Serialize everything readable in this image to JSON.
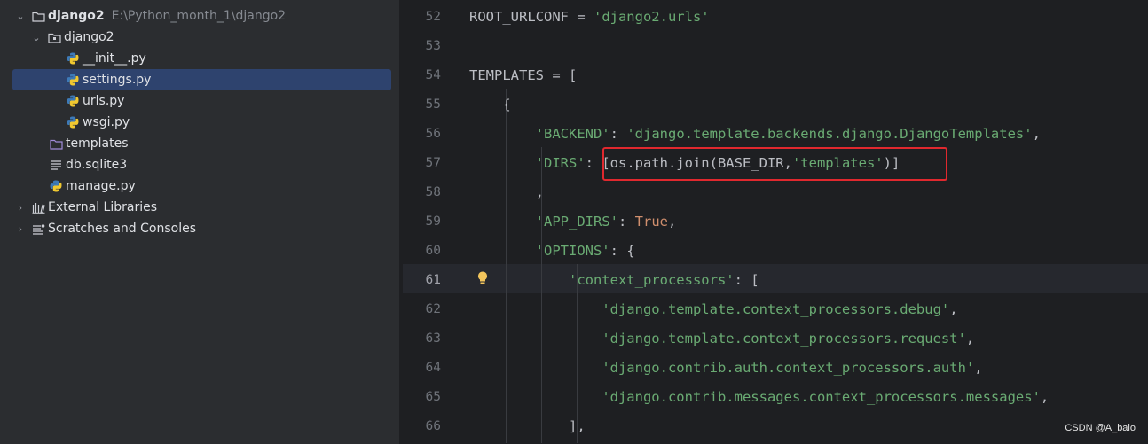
{
  "project_tree": {
    "root": {
      "name": "django2",
      "path": "E:\\Python_month_1\\django2"
    },
    "items": [
      {
        "label": "django2",
        "icon": "folder-icon"
      },
      {
        "label": "__init__.py",
        "icon": "python-file-icon"
      },
      {
        "label": "settings.py",
        "icon": "python-file-icon",
        "selected": true
      },
      {
        "label": "urls.py",
        "icon": "python-file-icon"
      },
      {
        "label": "wsgi.py",
        "icon": "python-file-icon"
      },
      {
        "label": "templates",
        "icon": "folder-icon"
      },
      {
        "label": "db.sqlite3",
        "icon": "text-file-icon"
      },
      {
        "label": "manage.py",
        "icon": "python-file-icon"
      },
      {
        "label": "External Libraries",
        "icon": "library-icon"
      },
      {
        "label": "Scratches and Consoles",
        "icon": "scratches-icon"
      }
    ]
  },
  "editor": {
    "current_line": "61",
    "lines": [
      {
        "num": "52",
        "tokens": [
          [
            "p",
            "ROOT_URLCONF = "
          ],
          [
            "s",
            "'django2.urls'"
          ]
        ]
      },
      {
        "num": "53",
        "tokens": []
      },
      {
        "num": "54",
        "tokens": [
          [
            "p",
            "TEMPLATES = ["
          ]
        ]
      },
      {
        "num": "55",
        "tokens": [
          [
            "p",
            "    {"
          ]
        ]
      },
      {
        "num": "56",
        "tokens": [
          [
            "p",
            "        "
          ],
          [
            "s",
            "'BACKEND'"
          ],
          [
            "p",
            ": "
          ],
          [
            "s",
            "'django.template.backends.django.DjangoTemplates'"
          ],
          [
            "p",
            ","
          ]
        ]
      },
      {
        "num": "57",
        "tokens": [
          [
            "p",
            "        "
          ],
          [
            "s",
            "'DIRS'"
          ],
          [
            "p",
            ": [os.path.join(BASE_DIR,"
          ],
          [
            "s",
            "'templates'"
          ],
          [
            "p",
            ")]"
          ]
        ]
      },
      {
        "num": "58",
        "tokens": [
          [
            "p",
            "        ,"
          ]
        ]
      },
      {
        "num": "59",
        "tokens": [
          [
            "p",
            "        "
          ],
          [
            "s",
            "'APP_DIRS'"
          ],
          [
            "p",
            ": "
          ],
          [
            "k",
            "True"
          ],
          [
            "p",
            ","
          ]
        ]
      },
      {
        "num": "60",
        "tokens": [
          [
            "p",
            "        "
          ],
          [
            "s",
            "'OPTIONS'"
          ],
          [
            "p",
            ": {"
          ]
        ]
      },
      {
        "num": "61",
        "tokens": [
          [
            "p",
            "            "
          ],
          [
            "s",
            "'context_processors'"
          ],
          [
            "p",
            ": ["
          ]
        ]
      },
      {
        "num": "62",
        "tokens": [
          [
            "p",
            "                "
          ],
          [
            "s",
            "'django.template.context_processors.debug'"
          ],
          [
            "p",
            ","
          ]
        ]
      },
      {
        "num": "63",
        "tokens": [
          [
            "p",
            "                "
          ],
          [
            "s",
            "'django.template.context_processors.request'"
          ],
          [
            "p",
            ","
          ]
        ]
      },
      {
        "num": "64",
        "tokens": [
          [
            "p",
            "                "
          ],
          [
            "s",
            "'django.contrib.auth.context_processors.auth'"
          ],
          [
            "p",
            ","
          ]
        ]
      },
      {
        "num": "65",
        "tokens": [
          [
            "p",
            "                "
          ],
          [
            "s",
            "'django.contrib.messages.context_processors.messages'"
          ],
          [
            "p",
            ","
          ]
        ]
      },
      {
        "num": "66",
        "tokens": [
          [
            "p",
            "            ],"
          ]
        ]
      }
    ]
  },
  "watermark": "CSDN @A_baio",
  "colors": {
    "string": "#6aab73",
    "keyword": "#cf8e6d",
    "plain": "#bcbec4",
    "highlight_box": "#e0282e",
    "selection": "#2e436e"
  }
}
